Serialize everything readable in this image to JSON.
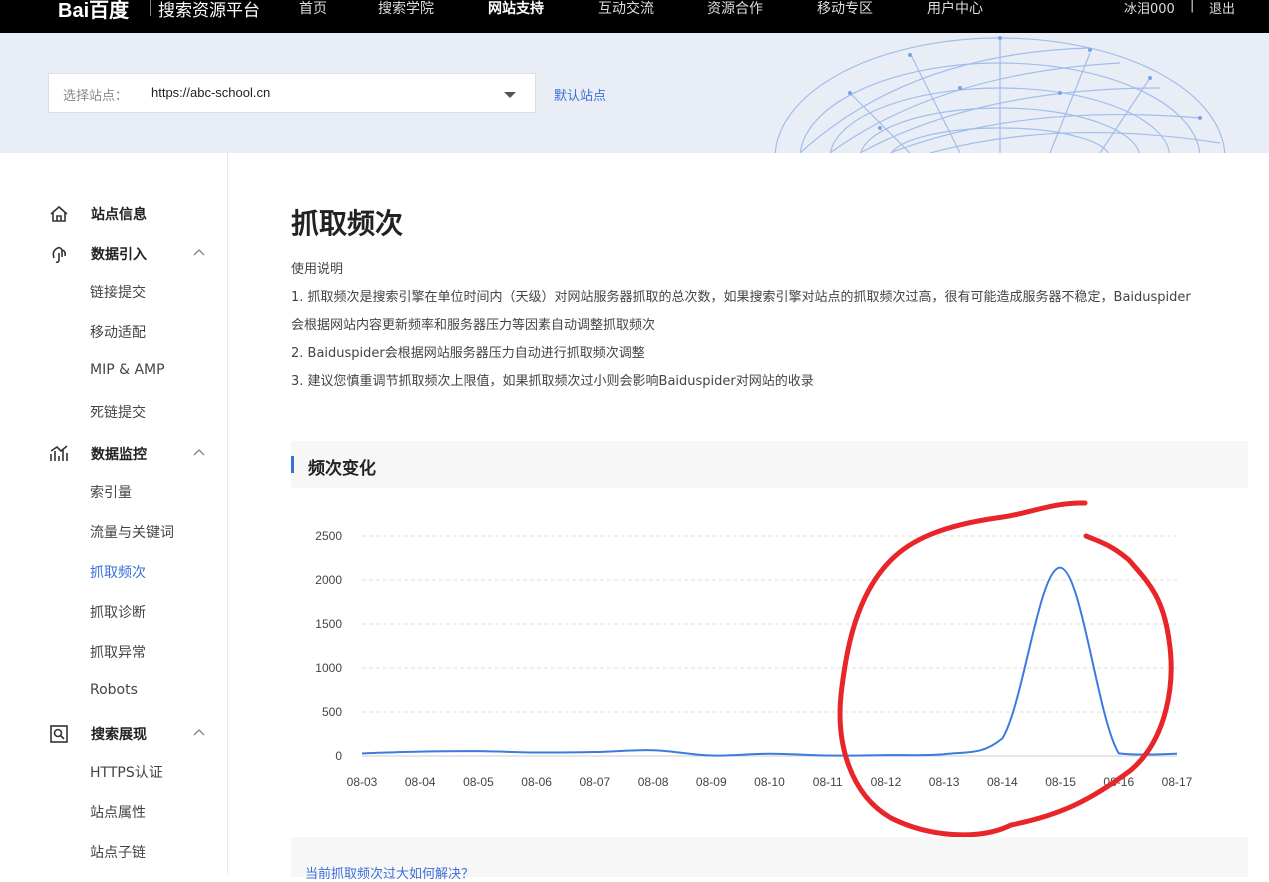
{
  "topnav": {
    "logo": "Bai百度",
    "platform": "搜索资源平台",
    "items": [
      "首页",
      "搜索学院",
      "网站支持",
      "互动交流",
      "资源合作",
      "移动专区",
      "用户中心"
    ],
    "active_index": 2,
    "username": "冰泪000",
    "separator": "|",
    "logout": "退出"
  },
  "site_select": {
    "label": "选择站点：",
    "value": "https://abc-school.cn",
    "default_link": "默认站点"
  },
  "sidebar": {
    "groups": [
      {
        "label": "站点信息",
        "icon": "home-icon",
        "items": []
      },
      {
        "label": "数据引入",
        "icon": "data-import-icon",
        "items": [
          "链接提交",
          "移动适配",
          "MIP & AMP",
          "死链提交"
        ]
      },
      {
        "label": "数据监控",
        "icon": "monitor-chart-icon",
        "items": [
          "索引量",
          "流量与关键词",
          "抓取频次",
          "抓取诊断",
          "抓取异常",
          "Robots"
        ]
      },
      {
        "label": "搜索展现",
        "icon": "search-display-icon",
        "items": [
          "HTTPS认证",
          "站点属性",
          "站点子链"
        ]
      }
    ],
    "active_item": "抓取频次"
  },
  "main": {
    "title": "抓取频次",
    "desc_title": "使用说明",
    "desc_lines": [
      "1. 抓取频次是搜索引擎在单位时间内（天级）对网站服务器抓取的总次数，如果搜索引擎对站点的抓取频次过高，很有可能造成服务器不稳定，Baiduspider",
      "会根据网站内容更新频率和服务器压力等因素自动调整抓取频次",
      "2. Baiduspider会根据网站服务器压力自动进行抓取频次调整",
      "3. 建议您慎重调节抓取频次上限值，如果抓取频次过小则会影响Baiduspider对网站的收录"
    ],
    "section_title": "频次变化",
    "bottom_link": "当前抓取频次过大如何解决？"
  },
  "chart_data": {
    "type": "line",
    "x": [
      "08-03",
      "08-04",
      "08-05",
      "08-06",
      "08-07",
      "08-08",
      "08-09",
      "08-10",
      "08-11",
      "08-12",
      "08-13",
      "08-14",
      "08-15",
      "08-16",
      "08-17"
    ],
    "y": [
      30,
      50,
      55,
      40,
      45,
      65,
      5,
      25,
      5,
      10,
      20,
      200,
      2140,
      30,
      25
    ],
    "ylim": [
      0,
      2500
    ],
    "yticks": [
      0,
      500,
      1000,
      1500,
      2000,
      2500
    ],
    "grid": true,
    "line_color": "#3b7be0",
    "annotation_color": "#e8262a"
  }
}
